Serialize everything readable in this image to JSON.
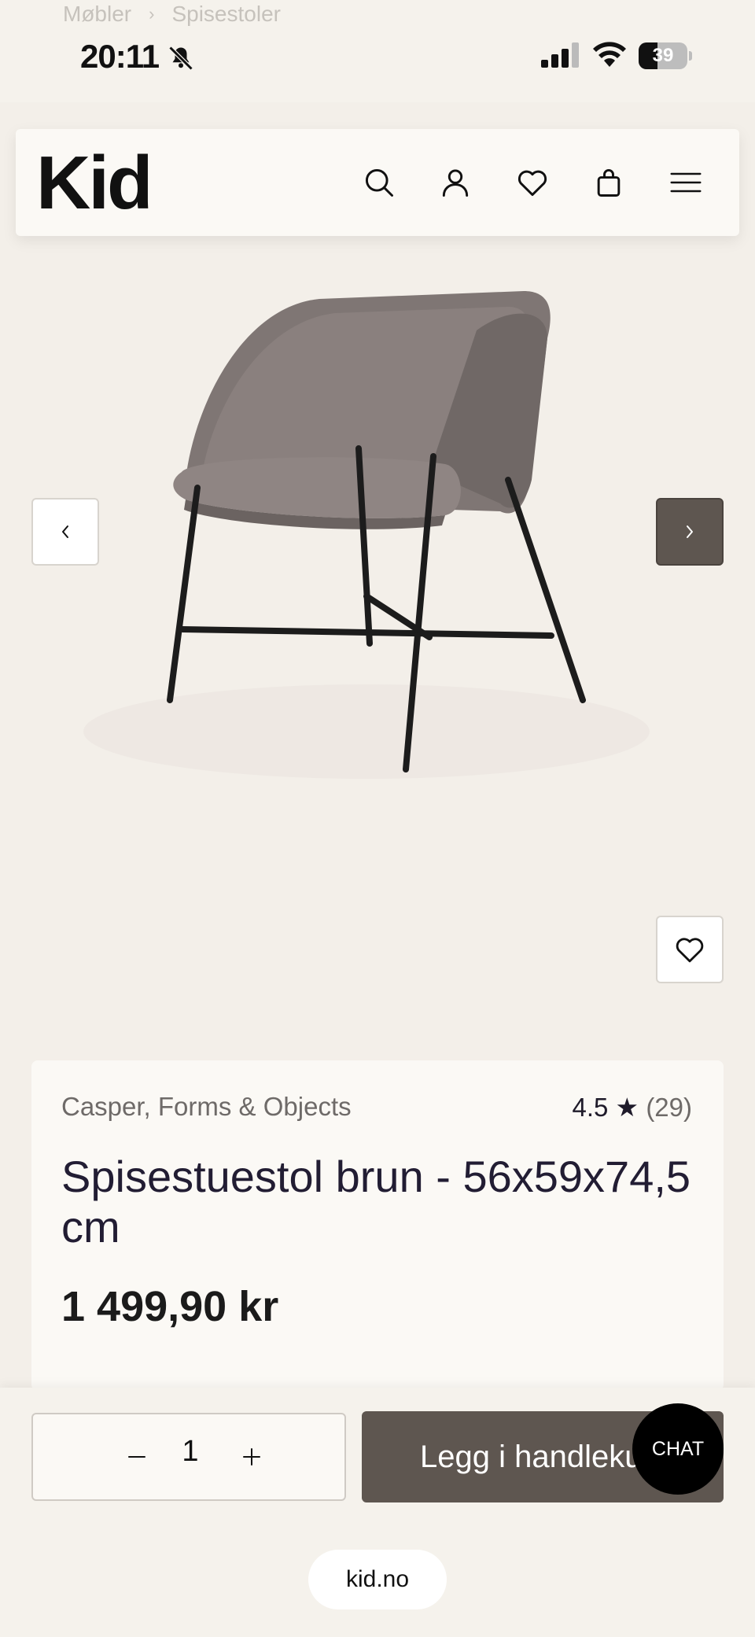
{
  "breadcrumb": {
    "items": [
      "Møbler",
      "Spisestoler"
    ]
  },
  "status": {
    "time": "20:11",
    "battery_percent": 39,
    "battery_label": "39"
  },
  "header": {
    "logo": "Kid",
    "icons": [
      "search-icon",
      "account-icon",
      "heart-icon",
      "bag-icon",
      "menu-icon"
    ]
  },
  "gallery": {
    "prev_icon": "chevron-left-icon",
    "next_icon": "chevron-right-icon",
    "favorite_icon": "heart-icon"
  },
  "product": {
    "brand": "Casper, Forms & Objects",
    "rating": "4.5 ★",
    "review_count": "(29)",
    "title": "Spisestuestol brun - 56x59x74,5 cm",
    "price": "1 499,90 kr"
  },
  "cart": {
    "quantity": "1",
    "add_label": "Legg i handlekurv",
    "chat_label": "CHAT"
  },
  "browser": {
    "url": "kid.no"
  },
  "colors": {
    "accent": "#5e5650",
    "background": "#f3efe9",
    "card": "#fbf9f5"
  }
}
